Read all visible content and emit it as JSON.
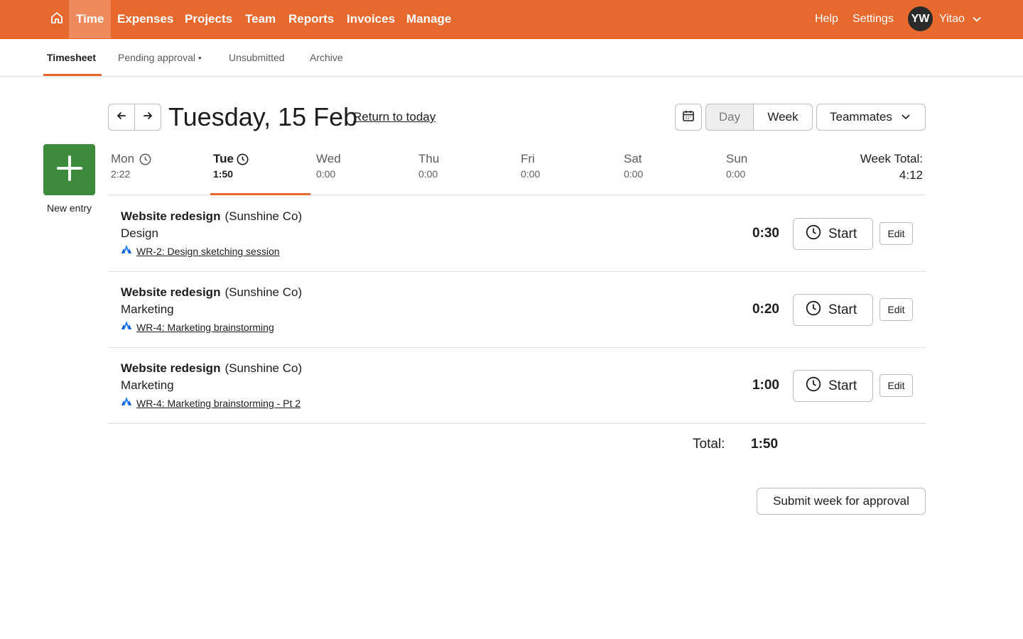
{
  "colors": {
    "brand": "#e8692e",
    "active_nav": "#ee8a5b",
    "new_entry": "#3c8a3b",
    "jira": "#2684ff"
  },
  "topnav": {
    "home_icon": "home-icon",
    "items": [
      {
        "label": "Time",
        "active": true
      },
      {
        "label": "Expenses"
      },
      {
        "label": "Projects"
      },
      {
        "label": "Team"
      },
      {
        "label": "Reports"
      },
      {
        "label": "Invoices"
      },
      {
        "label": "Manage"
      }
    ],
    "help": "Help",
    "settings": "Settings",
    "user_initials": "YW",
    "user_name": "Yitao"
  },
  "subnav": {
    "tabs": [
      {
        "label": "Timesheet",
        "active": true
      },
      {
        "label": "Pending approval •"
      },
      {
        "label": "Unsubmitted"
      },
      {
        "label": "Archive"
      }
    ]
  },
  "header": {
    "date_title": "Tuesday, 15 Feb",
    "return_link": "Return to today",
    "view_day": "Day",
    "view_week": "Week",
    "view_selected": "Day",
    "teammates": "Teammates"
  },
  "new_entry": {
    "label": "New entry"
  },
  "days": [
    {
      "name": "Mon",
      "value": "2:22",
      "clock": true
    },
    {
      "name": "Tue",
      "value": "1:50",
      "clock": true,
      "active": true
    },
    {
      "name": "Wed",
      "value": "0:00"
    },
    {
      "name": "Thu",
      "value": "0:00"
    },
    {
      "name": "Fri",
      "value": "0:00"
    },
    {
      "name": "Sat",
      "value": "0:00"
    },
    {
      "name": "Sun",
      "value": "0:00"
    }
  ],
  "week_total": {
    "label": "Week Total:",
    "value": "4:12"
  },
  "entries": [
    {
      "project": "Website redesign",
      "client": "(Sunshine Co)",
      "task": "Design",
      "jira": "WR-2: Design sketching session",
      "duration": "0:30",
      "start": "Start",
      "edit": "Edit"
    },
    {
      "project": "Website redesign",
      "client": "(Sunshine Co)",
      "task": "Marketing",
      "jira": "WR-4: Marketing brainstorming",
      "duration": "0:20",
      "start": "Start",
      "edit": "Edit"
    },
    {
      "project": "Website redesign",
      "client": "(Sunshine Co)",
      "task": "Marketing",
      "jira": "WR-4: Marketing brainstorming - Pt 2",
      "duration": "1:00",
      "start": "Start",
      "edit": "Edit"
    }
  ],
  "total": {
    "label": "Total:",
    "value": "1:50"
  },
  "submit": {
    "label": "Submit week for approval"
  }
}
